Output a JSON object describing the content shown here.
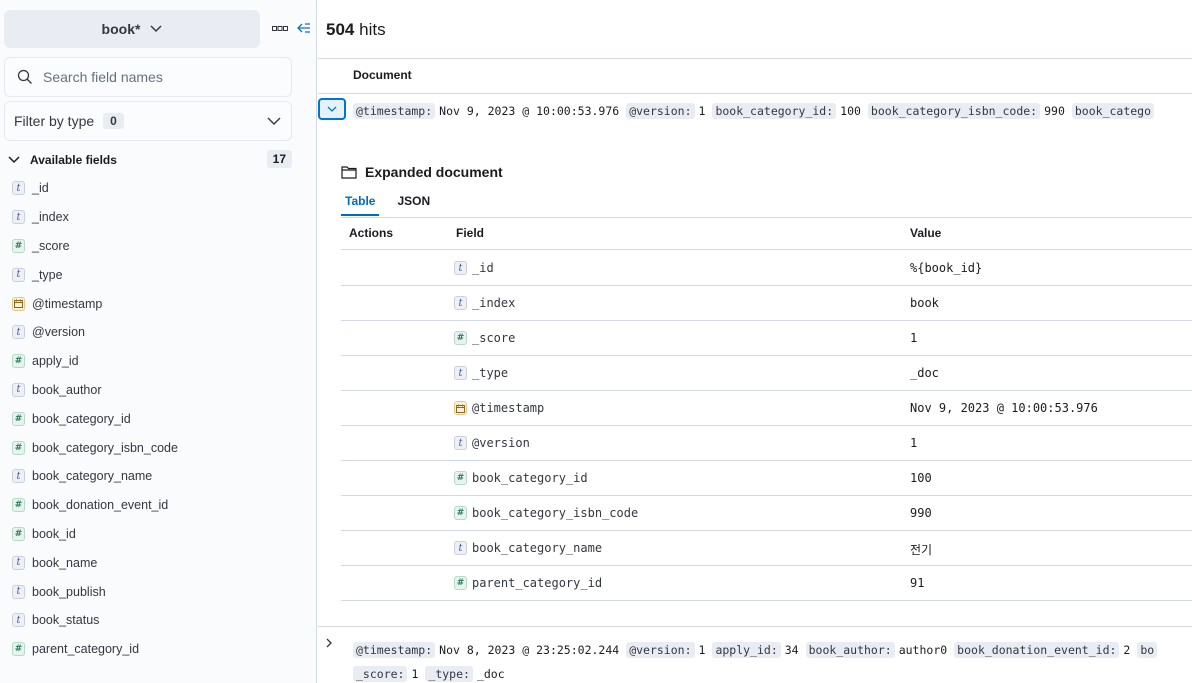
{
  "sidebar": {
    "data_view": "book*",
    "search_placeholder": "Search field names",
    "filter_label": "Filter by type",
    "filter_count": "0",
    "available_label": "Available fields",
    "available_count": "17",
    "fields": [
      {
        "type": "t",
        "name": "_id"
      },
      {
        "type": "t",
        "name": "_index"
      },
      {
        "type": "#",
        "name": "_score"
      },
      {
        "type": "t",
        "name": "_type"
      },
      {
        "type": "date",
        "name": "@timestamp"
      },
      {
        "type": "t",
        "name": "@version"
      },
      {
        "type": "#",
        "name": "apply_id"
      },
      {
        "type": "t",
        "name": "book_author"
      },
      {
        "type": "#",
        "name": "book_category_id"
      },
      {
        "type": "#",
        "name": "book_category_isbn_code"
      },
      {
        "type": "t",
        "name": "book_category_name"
      },
      {
        "type": "#",
        "name": "book_donation_event_id"
      },
      {
        "type": "#",
        "name": "book_id"
      },
      {
        "type": "t",
        "name": "book_name"
      },
      {
        "type": "t",
        "name": "book_publish"
      },
      {
        "type": "t",
        "name": "book_status"
      },
      {
        "type": "#",
        "name": "parent_category_id"
      }
    ]
  },
  "main": {
    "hits_count": "504",
    "hits_label": "hits",
    "document_col": "Document",
    "doc1_summary": [
      {
        "k": "@timestamp:",
        "v": "Nov 9, 2023 @ 10:00:53.976"
      },
      {
        "k": "@version:",
        "v": "1"
      },
      {
        "k": "book_category_id:",
        "v": "100"
      },
      {
        "k": "book_category_isbn_code:",
        "v": "990"
      },
      {
        "k": "book_catego",
        "v": ""
      }
    ],
    "expanded_title": "Expanded document",
    "tabs": [
      {
        "label": "Table",
        "active": true
      },
      {
        "label": "JSON",
        "active": false
      }
    ],
    "col_actions": "Actions",
    "col_field": "Field",
    "col_value": "Value",
    "detail_rows": [
      {
        "type": "t",
        "field": "_id",
        "value": "%{book_id}"
      },
      {
        "type": "t",
        "field": "_index",
        "value": "book"
      },
      {
        "type": "#",
        "field": "_score",
        "value": "1"
      },
      {
        "type": "t",
        "field": "_type",
        "value": "_doc"
      },
      {
        "type": "date",
        "field": "@timestamp",
        "value": "Nov 9, 2023 @ 10:00:53.976"
      },
      {
        "type": "t",
        "field": "@version",
        "value": "1"
      },
      {
        "type": "#",
        "field": "book_category_id",
        "value": "100"
      },
      {
        "type": "#",
        "field": "book_category_isbn_code",
        "value": "990"
      },
      {
        "type": "t",
        "field": "book_category_name",
        "value": "전기"
      },
      {
        "type": "#",
        "field": "parent_category_id",
        "value": "91"
      }
    ],
    "doc2_summary_line1": [
      {
        "k": "@timestamp:",
        "v": "Nov 8, 2023 @ 23:25:02.244"
      },
      {
        "k": "@version:",
        "v": "1"
      },
      {
        "k": "apply_id:",
        "v": "34"
      },
      {
        "k": "book_author:",
        "v": "author0"
      },
      {
        "k": "book_donation_event_id:",
        "v": "2"
      },
      {
        "k": "bo",
        "v": ""
      }
    ],
    "doc2_summary_line2": [
      {
        "k": "_score:",
        "v": "1"
      },
      {
        "k": "_type:",
        "v": "_doc"
      }
    ]
  },
  "colors": {
    "accent": "#0077cc",
    "border": "#d3dae6",
    "sidebar_bg": "#fafbfd"
  }
}
